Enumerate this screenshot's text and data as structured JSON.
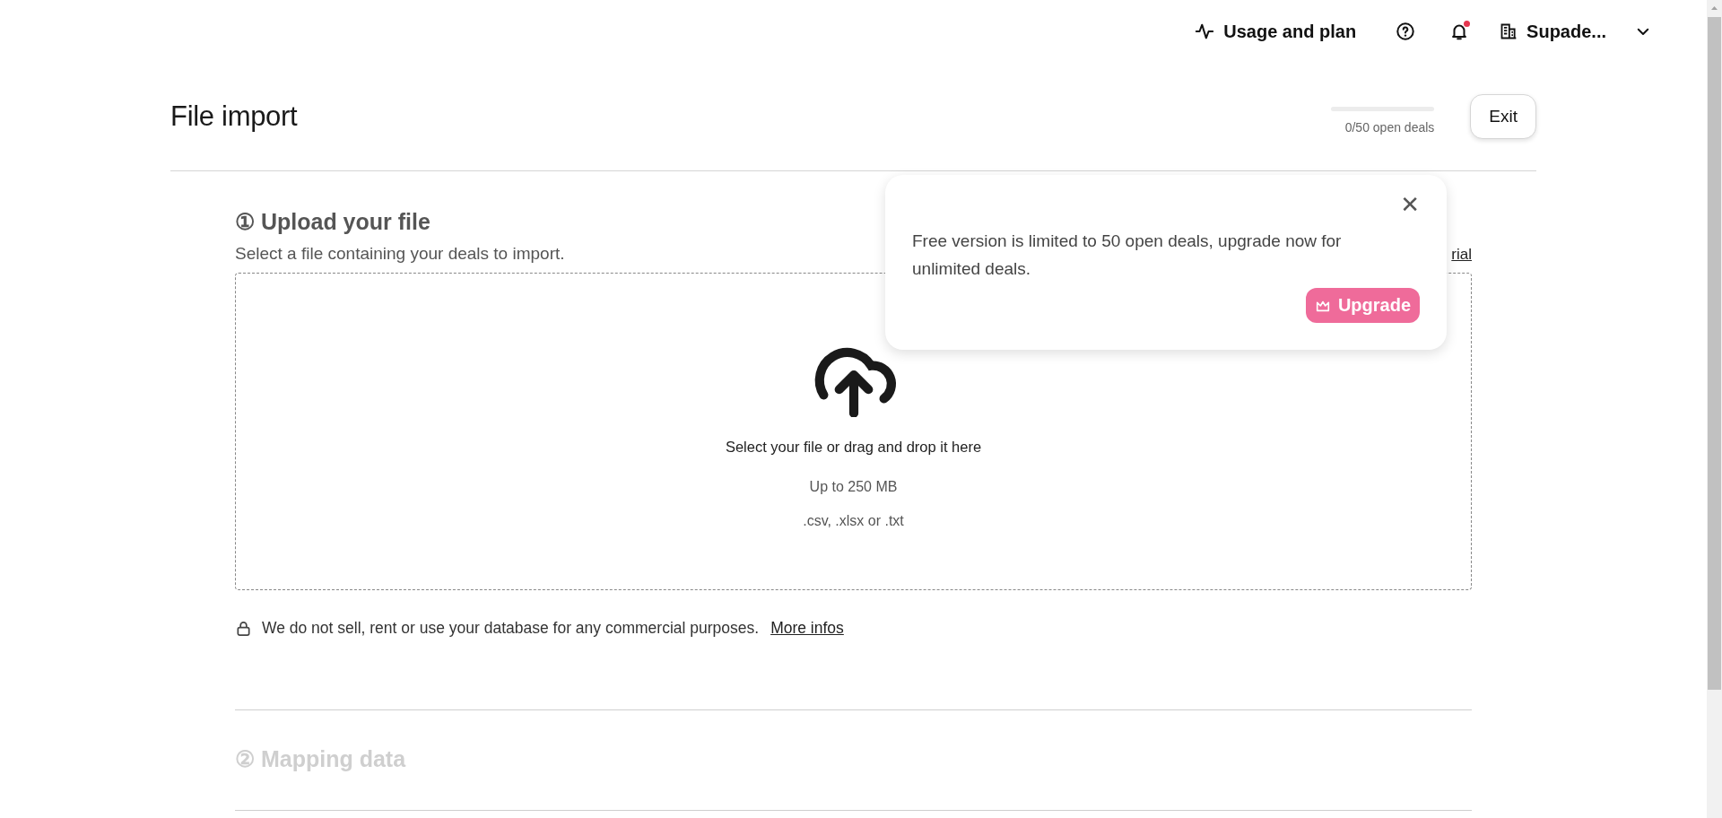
{
  "top_bar": {
    "usage_link": "Usage and plan",
    "notifications": {
      "unread": true
    },
    "account": {
      "name": "Supade..."
    }
  },
  "page": {
    "title": "File import",
    "deals_meter": {
      "level": 0,
      "label": "0/50 open deals"
    },
    "exit_button": "Exit"
  },
  "steps": [
    {
      "number": "①",
      "title": "Upload your file",
      "disabled": false
    },
    {
      "number": "②",
      "title": "Mapping data",
      "disabled": true
    }
  ],
  "upload": {
    "subtitle": "Select a file containing your deals to import.",
    "side_link": "rial",
    "dropzone": {
      "prompt": "Select your file or drag and drop it here",
      "size_limit": "Up to 250 MB",
      "formats": ".csv, .xlsx or .txt"
    },
    "privacy": {
      "text": "We do not sell, rent or use your database for any commercial purposes.",
      "link": "More infos"
    }
  },
  "popup": {
    "close": "✕",
    "message": "Free version is limited to 50 open deals, upgrade now for unlimited deals.",
    "button": "Upgrade"
  }
}
